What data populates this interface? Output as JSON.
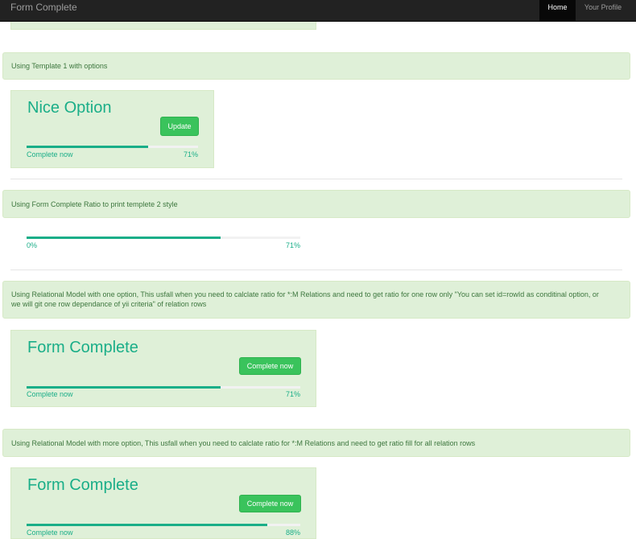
{
  "navbar": {
    "brand": "Form Complete",
    "items": [
      {
        "label": "Home",
        "active": true
      },
      {
        "label": "Your Profile",
        "active": false
      }
    ]
  },
  "sections": {
    "template1": {
      "alert": "Using Template 1 with options",
      "title": "Nice Option",
      "button": "Update",
      "progress_label": "Complete now",
      "progress_text": "71%",
      "progress_value": 0.71
    },
    "ratio": {
      "alert": "Using Form Complete Ratio to print templete 2 style",
      "start_label": "0%",
      "end_label": "71%",
      "progress_value": 0.71
    },
    "relational_one": {
      "alert_line1": "Using Relational Model with one option, This usfall when you need to calclate ratio for *:M Relations and need to get ratio for one row only \"You can set id=rowId as conditinal option, or",
      "alert_line2": "we will git one row dependance of yii criteria\" of relation rows",
      "title": "Form Complete",
      "button": "Complete now",
      "progress_label": "Complete now",
      "progress_text": "71%",
      "progress_value": 0.71
    },
    "relational_more": {
      "alert": "Using Relational Model with more option, This usfall when you need to calclate ratio for *:M Relations and need to get ratio fill for all relation rows",
      "title": "Form Complete",
      "button": "Complete now",
      "progress_label": "Complete now",
      "progress_text": "88%",
      "progress_value": 0.88
    }
  },
  "colors": {
    "accent": "#1aae88",
    "alert_bg": "#dff0d8",
    "alert_text": "#3c763d",
    "button": "#3ac35c",
    "navbar": "#222222"
  }
}
